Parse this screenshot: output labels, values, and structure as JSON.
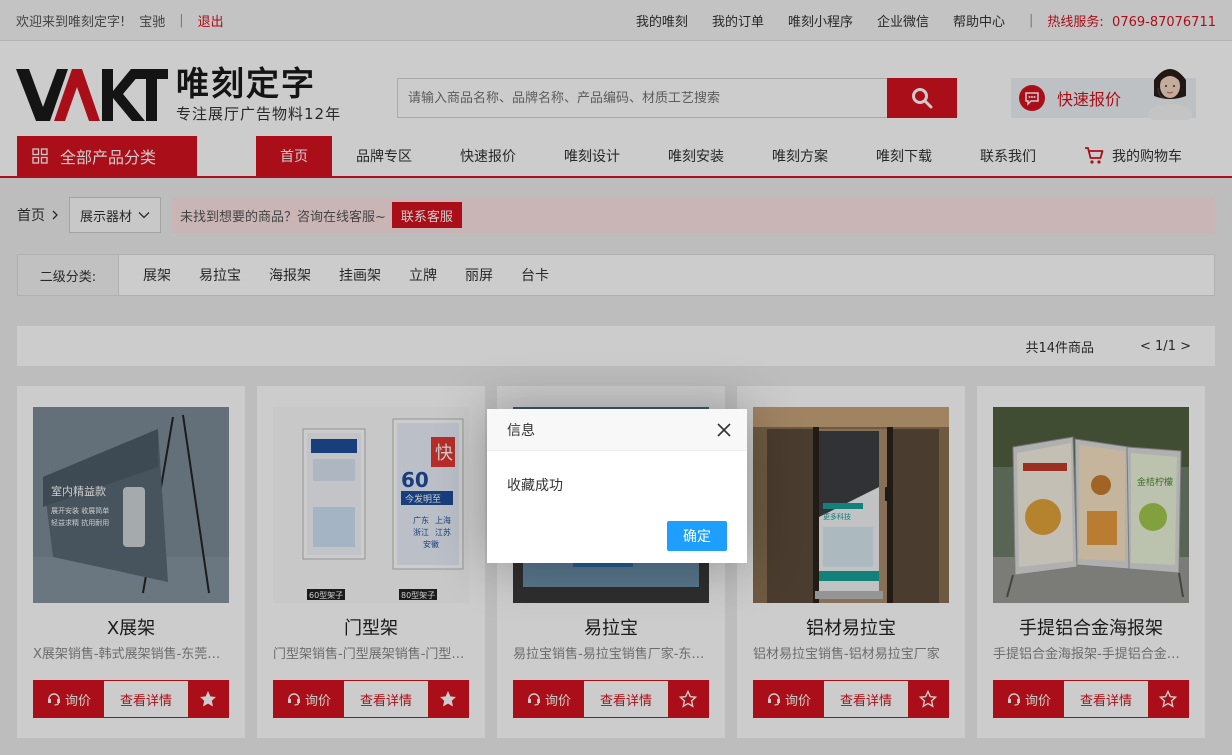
{
  "topbar": {
    "welcome": "欢迎来到唯刻定字!",
    "username": "宝驰",
    "divider": "|",
    "logout": "退出",
    "links": [
      "我的唯刻",
      "我的订单",
      "唯刻小程序",
      "企业微信",
      "帮助中心"
    ],
    "hotline_label": "热线服务:",
    "hotline_number": "0769-87076711"
  },
  "header": {
    "logo_name": "唯刻定字",
    "logo_slogan": "专注展厅广告物料12年",
    "search_placeholder": "请输入商品名称、品牌名称、产品编码、材质工艺搜索",
    "quick_quote": "快速报价"
  },
  "nav": {
    "all_categories": "全部产品分类",
    "items": [
      "首页",
      "品牌专区",
      "快速报价",
      "唯刻设计",
      "唯刻安装",
      "唯刻方案",
      "唯刻下载",
      "联系我们",
      "我的购物车"
    ]
  },
  "breadcrumb": {
    "home": "首页",
    "current": "展示器材",
    "notice": "未找到想要的商品？咨询在线客服~",
    "contact": "联系客服"
  },
  "subcategory": {
    "label": "二级分类:",
    "options": [
      "展架",
      "易拉宝",
      "海报架",
      "挂画架",
      "立牌",
      "丽屏",
      "台卡"
    ]
  },
  "results": {
    "count": "共14件商品",
    "pager": "< 1/1 >"
  },
  "products": [
    {
      "name": "X展架",
      "desc": "X展架销售-韩式展架销售-东莞展架",
      "ask": "询价",
      "detail": "查看详情",
      "favorited": true,
      "img_text": [
        "室内精益款",
        "展开安装 收展简单",
        "轻益求精 抗用耐用"
      ]
    },
    {
      "name": "门型架",
      "desc": "门型架销售-门型展架销售-门型架厂家",
      "ask": "询价",
      "detail": "查看详情",
      "favorited": true,
      "img_text": [
        "60型架子",
        "80型架子",
        "60",
        "快",
        "今发明至",
        "广东",
        "上海",
        "浙江",
        "江苏",
        "安徽"
      ]
    },
    {
      "name": "易拉宝",
      "desc": "易拉宝销售-易拉宝销售厂家-东莞易拉宝",
      "ask": "询价",
      "detail": "查看详情",
      "favorited": false,
      "img_text": []
    },
    {
      "name": "铝材易拉宝",
      "desc": "铝材易拉宝销售-铝材易拉宝厂家",
      "ask": "询价",
      "detail": "查看详情",
      "favorited": false,
      "img_text": [
        "更多科技"
      ]
    },
    {
      "name": "手提铝合金海报架",
      "desc": "手提铝合金海报架-手提铝合金海报架厂家",
      "ask": "询价",
      "detail": "查看详情",
      "favorited": false,
      "img_text": [
        "金桔柠檬"
      ]
    }
  ],
  "dialog": {
    "title": "信息",
    "message": "收藏成功",
    "confirm": "确定"
  },
  "colors": {
    "brand_red": "#d5121e",
    "dialog_button": "#1e9fff"
  }
}
